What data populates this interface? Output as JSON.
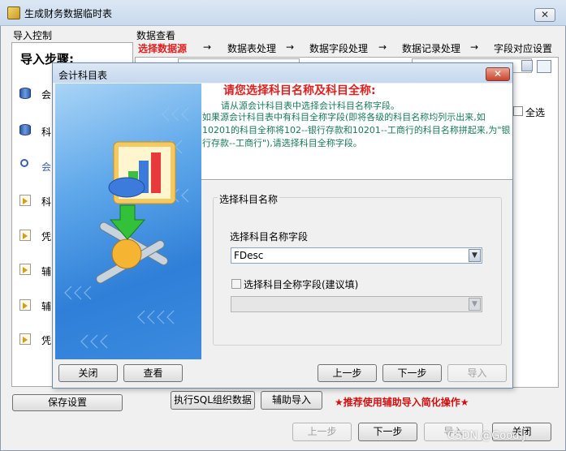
{
  "outer": {
    "title": "生成财务数据临时表",
    "close_symbol": "✕",
    "left_group_label": "导入控制",
    "steps_title": "导入步骤:",
    "steps": [
      {
        "label": "会",
        "icon": "database-icon"
      },
      {
        "label": "科",
        "icon": "database-icon"
      },
      {
        "label": "会",
        "icon": "search-icon"
      },
      {
        "label": "科",
        "icon": "arrow-icon"
      },
      {
        "label": "凭",
        "icon": "arrow-icon"
      },
      {
        "label": "辅",
        "icon": "arrow-icon"
      },
      {
        "label": "辅",
        "icon": "arrow-icon"
      },
      {
        "label": "凭",
        "icon": "arrow-icon"
      }
    ],
    "data_view_label": "数据查看",
    "wizard_steps": [
      "选择数据源",
      "数据表处理",
      "数据字段处理",
      "数据记录处理",
      "字段对应设置"
    ],
    "wizard_arrow": "→",
    "select_all": "全选",
    "save_settings": "保存设置",
    "exec_sql": "执行SQL组织数据",
    "aux_import": "辅助导入",
    "hint": "★推荐使用辅助导入简化操作★",
    "buttons": {
      "prev": "上一步",
      "next": "下一步",
      "import": "导入",
      "close": "关闭"
    }
  },
  "dialog": {
    "title": "会计科目表",
    "close_symbol": "✕",
    "heading": "请您选择科目名称及科目全称:",
    "desc1": "请从源会计科目表中选择会计科目名称字段。",
    "desc2": "如果源会计科目表中有科目全称字段(即将各级的科目名称均列示出来,如10201的科目全称将102--银行存款和10201--工商行的科目名称拼起来,为\"银行存款--工商行\"),请选择科目全称字段。",
    "group_title": "选择科目名称",
    "field_label": "选择科目名称字段",
    "field_value": "FDesc",
    "full_name_label": "选择科目全称字段(建议填)",
    "full_name_value": "",
    "buttons": {
      "close": "关闭",
      "view": "查看",
      "prev": "上一步",
      "next": "下一步",
      "import": "导入"
    }
  },
  "watermark": "CSDN @Good.J"
}
